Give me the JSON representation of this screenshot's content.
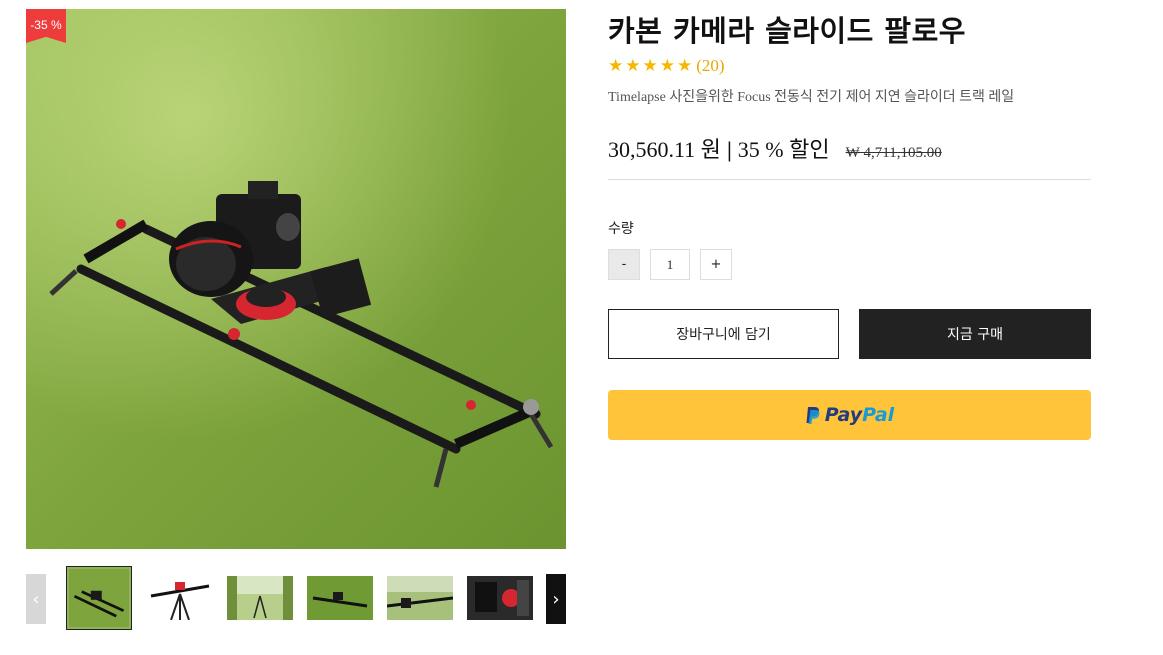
{
  "product": {
    "title": "카본 카메라 슬라이드 팔로우",
    "stars": "★★★★★",
    "review_count": "(20)",
    "subtitle": "Timelapse 사진을위한 Focus 전동식 전기 제어 지연 슬라이더 트랙 레일",
    "price": "30,560.11 원",
    "separator": "|",
    "discount": "35 % 할인",
    "original_price": "₩ 4,711,105.00",
    "badge": "-35 %",
    "rating": 5
  },
  "quantity": {
    "label": "수량",
    "value": "1",
    "minus": "-",
    "plus": "+"
  },
  "buttons": {
    "add_to_cart": "장바구니에 담기",
    "buy_now": "지금 구매",
    "paypal_pay": "Pay",
    "paypal_pal": "Pal"
  },
  "gallery": {
    "prev_icon": "‹",
    "next_icon": "›",
    "thumbnail_count": 6,
    "active_index": 0
  },
  "colors": {
    "badge": "#ee3b3b",
    "star": "#f5b800",
    "paypal_button": "#ffc439",
    "paypal_dark_blue": "#253b80",
    "paypal_light_blue": "#179bd7",
    "buy_button": "#222222"
  }
}
